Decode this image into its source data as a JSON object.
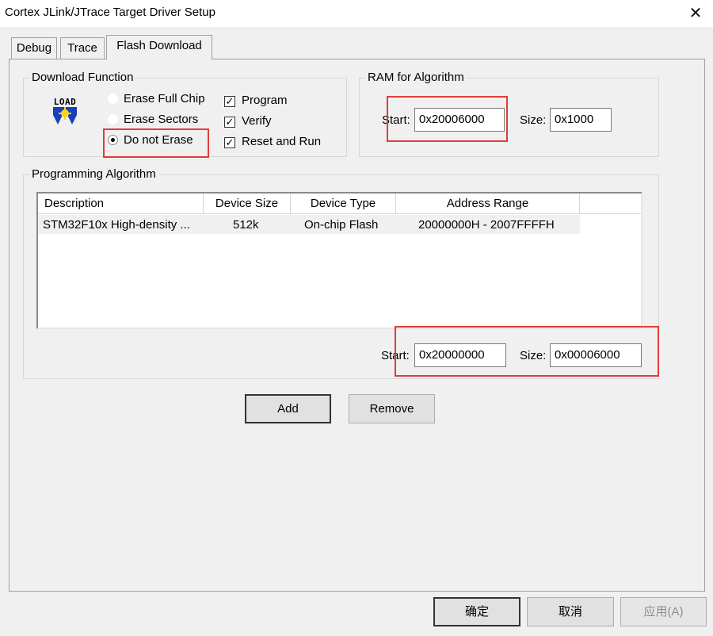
{
  "window": {
    "title": "Cortex JLink/JTrace Target Driver Setup",
    "close_glyph": "✕"
  },
  "tabs": [
    {
      "label": "Debug",
      "active": false
    },
    {
      "label": "Trace",
      "active": false
    },
    {
      "label": "Flash Download",
      "active": true
    }
  ],
  "download_function": {
    "title": "Download Function",
    "icon": "load-icon",
    "icon_text": "LOAD",
    "radios": [
      {
        "label": "Erase Full Chip",
        "selected": false
      },
      {
        "label": "Erase Sectors",
        "selected": false
      },
      {
        "label": "Do not Erase",
        "selected": true
      }
    ],
    "checks": [
      {
        "label": "Program",
        "checked": true
      },
      {
        "label": "Verify",
        "checked": true
      },
      {
        "label": "Reset and Run",
        "checked": true
      }
    ]
  },
  "ram_for_algorithm": {
    "title": "RAM for Algorithm",
    "start_label": "Start:",
    "start_value": "0x20006000",
    "size_label": "Size:",
    "size_value": "0x1000"
  },
  "programming_algorithm": {
    "title": "Programming Algorithm",
    "columns": [
      "Description",
      "Device Size",
      "Device Type",
      "Address Range"
    ],
    "rows": [
      [
        "STM32F10x High-density ...",
        "512k",
        "On-chip Flash",
        "20000000H - 2007FFFFH"
      ]
    ],
    "start_label": "Start:",
    "start_value": "0x20000000",
    "size_label": "Size:",
    "size_value": "0x00006000"
  },
  "buttons": {
    "add": "Add",
    "remove": "Remove"
  },
  "footer": {
    "ok": "确定",
    "cancel": "取消",
    "apply": "应用(A)"
  },
  "colors": {
    "highlight": "#e03c3c",
    "panel": "#f0f0f0"
  }
}
